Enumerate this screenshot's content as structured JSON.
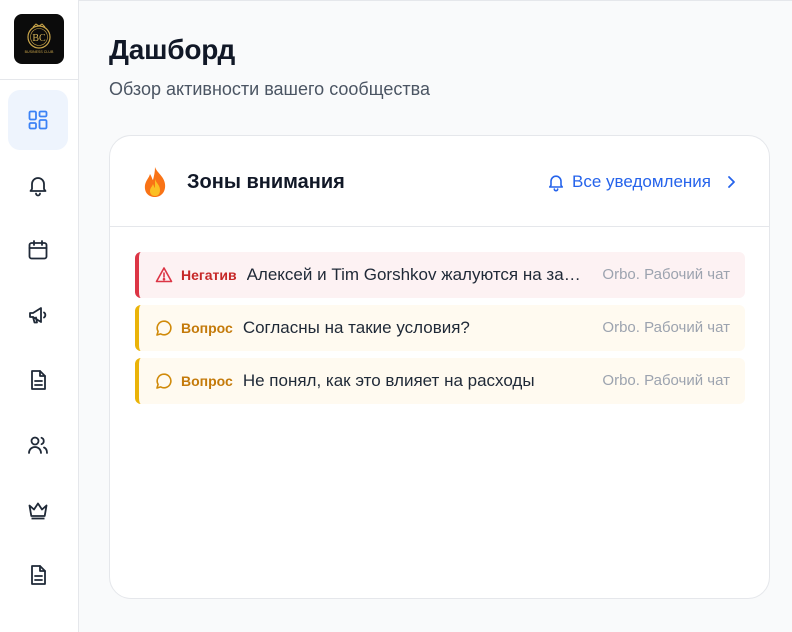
{
  "logo": {
    "text": "BUSINESS CLUB"
  },
  "sidebar": {
    "items": [
      {
        "icon": "dashboard-icon",
        "active": true
      },
      {
        "icon": "bell-icon",
        "active": false
      },
      {
        "icon": "calendar-icon",
        "active": false
      },
      {
        "icon": "megaphone-icon",
        "active": false
      },
      {
        "icon": "document-icon",
        "active": false
      },
      {
        "icon": "users-icon",
        "active": false
      },
      {
        "icon": "crown-icon",
        "active": false
      },
      {
        "icon": "document-icon",
        "active": false
      }
    ]
  },
  "page": {
    "title": "Дашборд",
    "subtitle": "Обзор активности вашего сообщества"
  },
  "attention_card": {
    "title": "Зоны внимания",
    "all_notifications_label": "Все уведомления",
    "items": [
      {
        "type": "negative",
        "tag": "Негатив",
        "text": "Алексей и Tim Gorshkov жалуются на задержку",
        "source": "Orbo. Рабочий чат",
        "icon": "warning-triangle-icon",
        "color": "#dc3545"
      },
      {
        "type": "question",
        "tag": "Вопрос",
        "text": "Согласны на такие условия?",
        "source": "Orbo. Рабочий чат",
        "icon": "chat-bubble-icon",
        "color": "#eab308"
      },
      {
        "type": "question",
        "tag": "Вопрос",
        "text": "Не понял, как это влияет на расходы",
        "source": "Orbo. Рабочий чат",
        "icon": "chat-bubble-icon",
        "color": "#eab308"
      }
    ]
  },
  "colors": {
    "accent": "#2563eb",
    "negative": "#dc3545",
    "question": "#eab308",
    "active_nav_bg": "#eef4fd"
  }
}
